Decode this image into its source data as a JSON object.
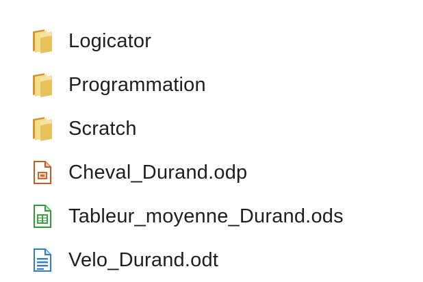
{
  "files": [
    {
      "name": "Logicator",
      "icon": "folder-icon"
    },
    {
      "name": "Programmation",
      "icon": "folder-icon"
    },
    {
      "name": "Scratch",
      "icon": "folder-icon"
    },
    {
      "name": "Cheval_Durand.odp",
      "icon": "presentation-file-icon"
    },
    {
      "name": "Tableur_moyenne_Durand.ods",
      "icon": "spreadsheet-file-icon"
    },
    {
      "name": "Velo_Durand.odt",
      "icon": "text-document-file-icon"
    }
  ],
  "colors": {
    "folder": "#e8c35a",
    "presentation": "#d0662a",
    "spreadsheet": "#3aa445",
    "text_document": "#2f7dcc"
  }
}
